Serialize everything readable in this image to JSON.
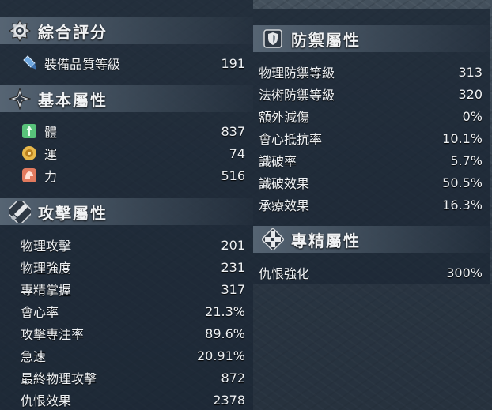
{
  "overall": {
    "title": "綜合評分",
    "gear_score_label": "裝備品質等級",
    "gear_score_value": "191"
  },
  "basic": {
    "title": "基本屬性",
    "items": [
      {
        "label": "體",
        "value": "837",
        "icon": "body-stat-icon"
      },
      {
        "label": "運",
        "value": "74",
        "icon": "luck-stat-icon"
      },
      {
        "label": "力",
        "value": "516",
        "icon": "strength-stat-icon"
      }
    ]
  },
  "attack": {
    "title": "攻擊屬性",
    "items": [
      {
        "label": "物理攻擊",
        "value": "201"
      },
      {
        "label": "物理強度",
        "value": "231"
      },
      {
        "label": "專精掌握",
        "value": "317"
      },
      {
        "label": "會心率",
        "value": "21.3%"
      },
      {
        "label": "攻擊專注率",
        "value": "89.6%"
      },
      {
        "label": "急速",
        "value": "20.91%"
      },
      {
        "label": "最終物理攻擊",
        "value": "872"
      },
      {
        "label": "仇恨效果",
        "value": "2378"
      }
    ]
  },
  "defense": {
    "title": "防禦屬性",
    "items": [
      {
        "label": "物理防禦等級",
        "value": "313"
      },
      {
        "label": "法術防禦等級",
        "value": "320"
      },
      {
        "label": "額外減傷",
        "value": "0%"
      },
      {
        "label": "會心抵抗率",
        "value": "10.1%"
      },
      {
        "label": "識破率",
        "value": "5.7%"
      },
      {
        "label": "識破效果",
        "value": "50.5%"
      },
      {
        "label": "承療效果",
        "value": "16.3%"
      }
    ]
  },
  "mastery": {
    "title": "專精屬性",
    "items": [
      {
        "label": "仇恨強化",
        "value": "300%"
      }
    ]
  },
  "colors": {
    "panel": "#1c2734",
    "header": "#5f6e7d",
    "text": "#eef1f4",
    "gem_blue": "#6fa8e0",
    "body_green": "#58c27a",
    "luck_gold": "#e8b84a",
    "strength_red": "#e27a5e"
  }
}
